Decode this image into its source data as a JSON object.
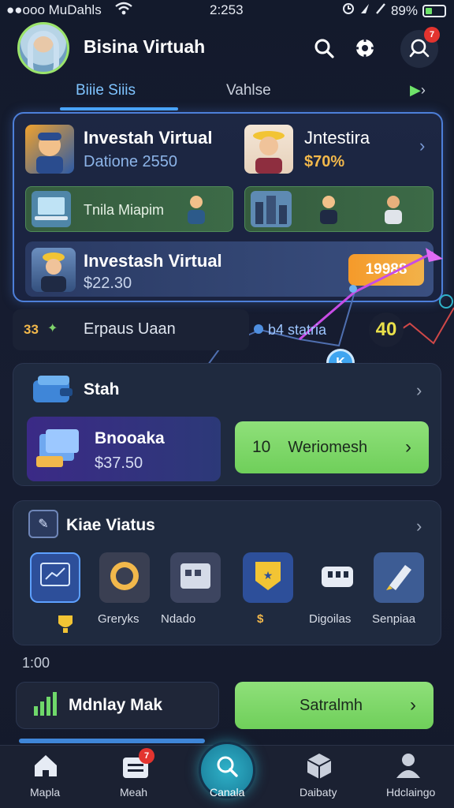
{
  "status_bar": {
    "carrier": "●●ooo MuDahls",
    "time": "2:253",
    "battery": "89%",
    "icons": [
      "wifi-icon",
      "alarm-icon",
      "location-icon",
      "signal-icon",
      "battery-icon"
    ]
  },
  "header": {
    "title": "Bisina Virtuah",
    "notification_count": "7",
    "icons": [
      "search-icon",
      "settings-icon",
      "network-icon"
    ]
  },
  "tabs": {
    "active": "Biiie Siiis",
    "inactive": "Vahlse"
  },
  "investments": {
    "card1": {
      "title": "Investah Virtual",
      "subtitle": "Datione 2550"
    },
    "card2": {
      "title": "Jntestira",
      "subtitle": "$70%"
    },
    "green_row1": {
      "label": "Tnila Miapim"
    },
    "card3": {
      "title": "Investash Virtual",
      "subtitle": "$22.30",
      "badge": "19988"
    }
  },
  "expenses_row": {
    "prefix": "33",
    "label": "Erpaus Uaan",
    "chart_label": "b4 statria",
    "value": "40"
  },
  "search_card": {
    "title": "Stah",
    "product": {
      "title": "Bnooaka",
      "price": "$37.50"
    },
    "action": {
      "count": "10",
      "label": "Weriomesh"
    }
  },
  "kiae_card": {
    "title": "Kiae Viatus",
    "items": [
      {
        "label": ""
      },
      {
        "label": "Greryks"
      },
      {
        "label": "Ndado"
      },
      {
        "label": "$"
      },
      {
        "label": "Digoilas"
      },
      {
        "label": "Senpiaa"
      }
    ]
  },
  "section_time": "1:00",
  "bottom_actions": {
    "left_label": "Mdnlay Mak",
    "right_label": "Satralmh"
  },
  "bottom_nav": {
    "items": [
      {
        "label": "Mapla",
        "icon": "home-icon"
      },
      {
        "label": "Meah",
        "icon": "inbox-icon",
        "badge": "7"
      },
      {
        "label": "Canala",
        "icon": "search-icon"
      },
      {
        "label": "Daibaty",
        "icon": "box-icon"
      },
      {
        "label": "Hdclaingo",
        "icon": "profile-icon"
      }
    ]
  },
  "colors": {
    "background": "#141a2b",
    "accent_blue": "#49a8ff",
    "accent_green": "#78d663",
    "accent_gold": "#f2b84b",
    "badge_red": "#e3342f"
  }
}
